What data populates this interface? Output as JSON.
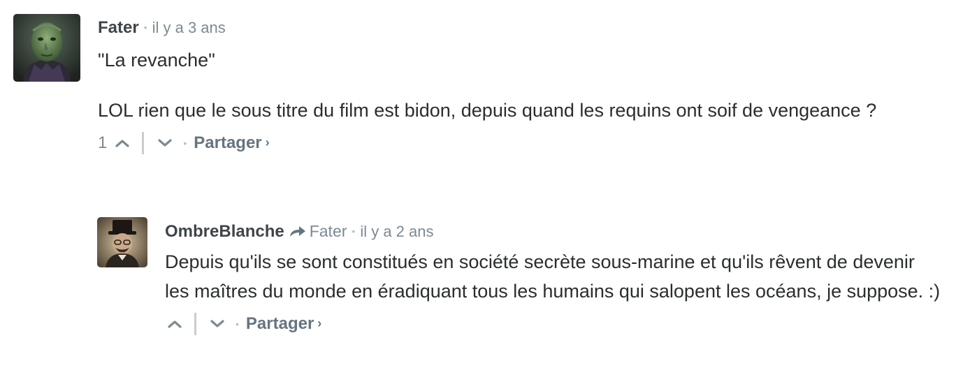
{
  "comments": [
    {
      "author": "Fater",
      "timestamp": "il y a 3 ans",
      "paragraphs": [
        "\"La revanche\"",
        "LOL rien que le sous titre du film est bidon, depuis quand les requins ont soif de vengeance ?"
      ],
      "votes": "1",
      "share_label": "Partager",
      "share_chevron": "›",
      "avatar_icon": "avatar-green-face",
      "separator": "•"
    },
    {
      "author": "OmbreBlanche",
      "reply_to": "Fater",
      "reply_icon": "reply-arrow-icon",
      "timestamp": "il y a 2 ans",
      "paragraphs": [
        "Depuis qu'ils se sont constitués en société secrète sous-marine et qu'ils rêvent de devenir les maîtres du monde en éradiquant tous les humains qui salopent les océans, je suppose. :)"
      ],
      "share_label": "Partager",
      "share_chevron": "›",
      "avatar_icon": "avatar-top-hat-man",
      "separator": "•"
    }
  ],
  "colors": {
    "text": "#2a2e2e",
    "meta": "#7c8a93",
    "share": "#65757f",
    "separator": "#b6c0c6"
  }
}
